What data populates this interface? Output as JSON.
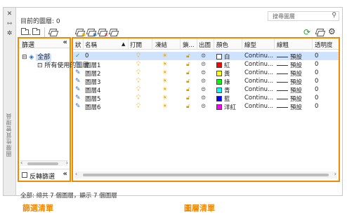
{
  "header": {
    "current_layer": "目前的圖層: 0",
    "search_placeholder": "搜尋圖層"
  },
  "side_strip": {
    "title": "圖層性質管理員",
    "icons": [
      "close-icon",
      "pin-icon",
      "settings-icon"
    ]
  },
  "toolbar": {
    "left": [
      "new-property-filter-icon",
      "new-group-filter-icon",
      "layer-states-manager-icon"
    ],
    "layer": [
      "new-layer-icon",
      "new-layer-vp-frozen-icon",
      "delete-layer-icon",
      "set-current-icon"
    ],
    "right": [
      "refresh-icon",
      "settings-icon"
    ]
  },
  "filter_panel": {
    "title": "篩選",
    "collapse": "«",
    "tree": {
      "all": "全部",
      "used": "所有使用的圖層"
    },
    "invert_label": "反轉篩選"
  },
  "layer_list": {
    "columns": [
      "狀",
      "名稱",
      "打開",
      "凍結",
      "鎖...",
      "出圖",
      "顏色",
      "線型",
      "線粗",
      "透明度"
    ],
    "rows": [
      {
        "name": "0",
        "color_name": "白",
        "color_hex": "#ffffff",
        "linetype": "Continu...",
        "lineweight": "預設",
        "transparency": "0",
        "current": true
      },
      {
        "name": "圖層1",
        "color_name": "紅",
        "color_hex": "#ff0000",
        "linetype": "Continu...",
        "lineweight": "預設",
        "transparency": "0",
        "current": false
      },
      {
        "name": "圖層2",
        "color_name": "黃",
        "color_hex": "#ffff00",
        "linetype": "Continu...",
        "lineweight": "預設",
        "transparency": "0",
        "current": false
      },
      {
        "name": "圖層3",
        "color_name": "綠",
        "color_hex": "#00ff00",
        "linetype": "Continu...",
        "lineweight": "預設",
        "transparency": "0",
        "current": false
      },
      {
        "name": "圖層4",
        "color_name": "青",
        "color_hex": "#00ffff",
        "linetype": "Continu...",
        "lineweight": "預設",
        "transparency": "0",
        "current": false
      },
      {
        "name": "圖層5",
        "color_name": "藍",
        "color_hex": "#0000ff",
        "linetype": "Continu...",
        "lineweight": "預設",
        "transparency": "0",
        "current": false
      },
      {
        "name": "圖層6",
        "color_name": "洋紅",
        "color_hex": "#ff00ff",
        "linetype": "Continu...",
        "lineweight": "預設",
        "transparency": "0",
        "current": false
      }
    ]
  },
  "status": "全部: 總共 7 個圖層，顯示 7 個圖層",
  "captions": {
    "filter": "篩選清單",
    "list": "圖層清單"
  },
  "accent_color": "#f08a00"
}
